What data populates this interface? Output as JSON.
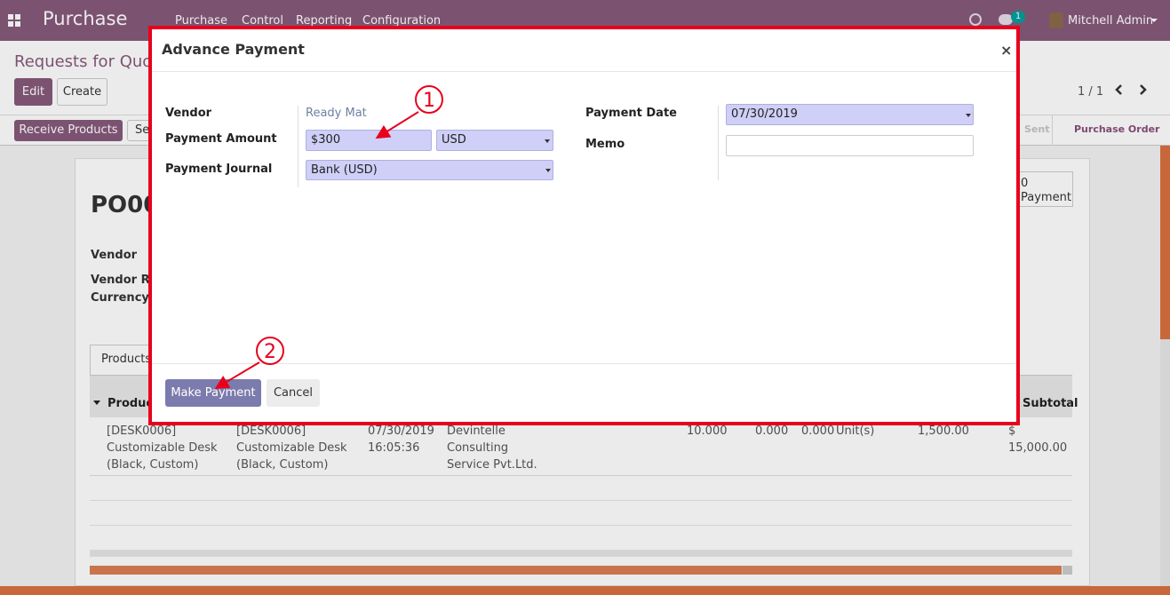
{
  "navbar": {
    "app_name": "Purchase",
    "menu": [
      "Purchase",
      "Control",
      "Reporting",
      "Configuration"
    ],
    "chat_count": "1",
    "user": "Mitchell Admin",
    "icons": {
      "apps": "apps-grid-icon",
      "activity": "clock-icon",
      "messages": "chat-icon"
    }
  },
  "control_panel": {
    "breadcrumb": "Requests for Quotation",
    "edit_label": "Edit",
    "create_label": "Create",
    "pager": "1 / 1"
  },
  "status_bar": {
    "receive_label": "Receive Products",
    "send_partial": "Se",
    "stages": [
      "Sent",
      "Purchase Order"
    ]
  },
  "form": {
    "po_number": "PO00",
    "labels": [
      "Vendor",
      "Vendor Re",
      "Currency"
    ],
    "smart_button": {
      "line1": "0",
      "line2": "Payment"
    },
    "tab": "Products",
    "columns": [
      "Produc",
      "Subtotal"
    ],
    "row": {
      "product": [
        "[DESK0006]",
        "Customizable Desk",
        "(Black, Custom)"
      ],
      "description": [
        "[DESK0006]",
        "Customizable Desk",
        "(Black, Custom)"
      ],
      "date": [
        "07/30/2019",
        "16:05:36"
      ],
      "vendor": [
        "Devintelle",
        "Consulting",
        "Service Pvt.Ltd."
      ],
      "qty": "10.000",
      "received": "0.000",
      "billed": "0.000",
      "uom": "Unit(s)",
      "unit_price": "1,500.00",
      "subtotal": "$ 15,000.00"
    }
  },
  "modal": {
    "title": "Advance Payment",
    "close": "×",
    "vendor_label": "Vendor",
    "vendor_value": "Ready Mat",
    "amount_label": "Payment Amount",
    "amount_value": "$300",
    "currency_value": "USD",
    "journal_label": "Payment Journal",
    "journal_value": "Bank (USD)",
    "date_label": "Payment Date",
    "date_value": "07/30/2019",
    "memo_label": "Memo",
    "memo_value": "",
    "make_payment_label": "Make Payment",
    "cancel_label": "Cancel"
  },
  "annotations": {
    "marker1": "1",
    "marker2": "2",
    "color": "#e8001c"
  },
  "colors": {
    "brand": "#875a7b",
    "modal_primary": "#7c7bad",
    "required_field": "#cfcff7",
    "highlight_border": "#e8001c"
  }
}
